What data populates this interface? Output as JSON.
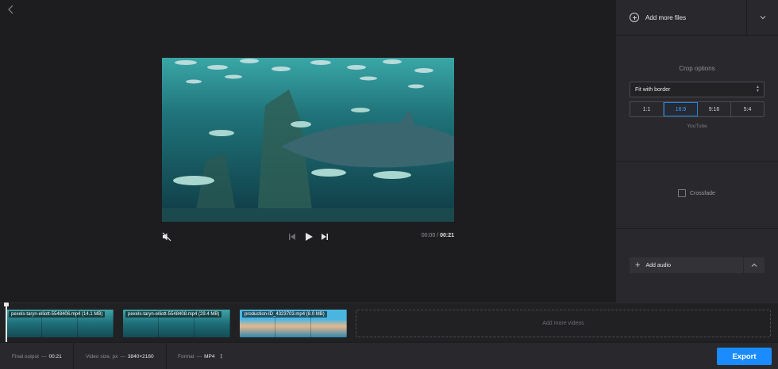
{
  "colors": {
    "accent": "#1a8cff",
    "active_ratio": "#3f9bff",
    "panel": "#29292d",
    "background": "#1d1d20"
  },
  "preview": {
    "back_icon": "chevron-left-icon",
    "player": {
      "mute_icon": "volume-muted-icon",
      "prev_icon": "skip-previous-icon",
      "play_icon": "play-icon",
      "next_icon": "skip-next-icon",
      "current_time": "00:00",
      "time_separator": "/",
      "total_time": "00:21"
    }
  },
  "panel": {
    "add_files_label": "Add more files",
    "add_files_icon": "plus-circle-icon",
    "files_toggle_icon": "chevron-down-icon",
    "crop": {
      "title": "Crop options",
      "mode": "Fit with border",
      "ratios": [
        {
          "label": "1:1",
          "active": false
        },
        {
          "label": "16:9",
          "active": true
        },
        {
          "label": "9:16",
          "active": false
        },
        {
          "label": "5:4",
          "active": false
        }
      ],
      "hint": "YouTube"
    },
    "crossfade_label": "Crossfade",
    "crossfade_checked": false,
    "add_audio_label": "Add audio",
    "audio_toggle_icon": "chevron-up-icon"
  },
  "timeline": {
    "clips": [
      {
        "label": "pexels-taryn-elliott-5548406.mp4 (14.1 MB)",
        "kind": "sea"
      },
      {
        "label": "pexels-taryn-elliott-5548408.mp4 (29.4 MB)",
        "kind": "sea"
      },
      {
        "label": "production-ID_4323703.mp4 (8.0 MB)",
        "kind": "beach"
      }
    ],
    "add_videos_label": "Add more videos"
  },
  "bottombar": {
    "final_output_label": "Final output",
    "final_output_value": "00:21",
    "video_size_label": "Video size, px",
    "video_size_value": "3840×2160",
    "format_label": "Format",
    "format_value": "MP4",
    "dash": "—",
    "export_label": "Export"
  }
}
